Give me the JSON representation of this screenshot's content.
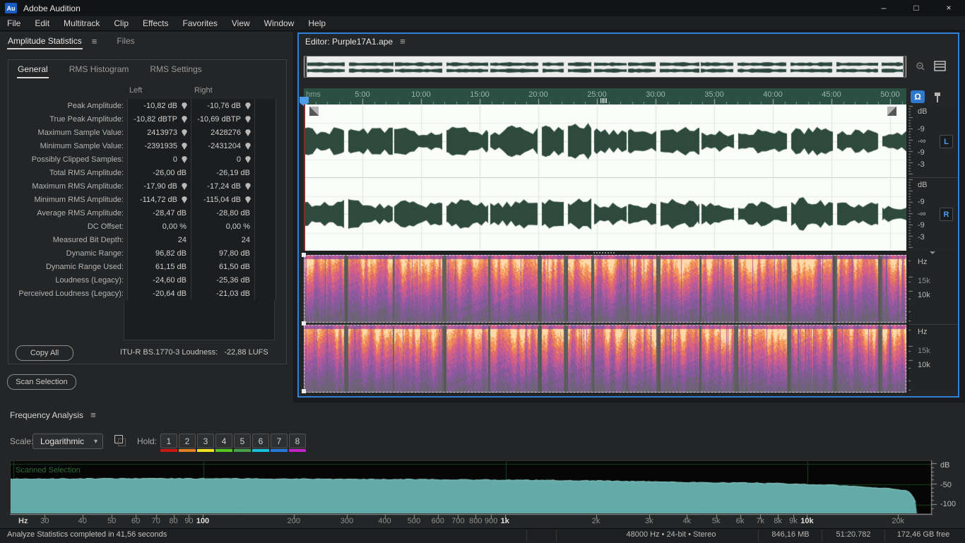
{
  "titlebar": {
    "logo": "Au",
    "title": "Adobe Audition",
    "minimize": "–",
    "maximize": "□",
    "close": "×"
  },
  "menubar": {
    "items": [
      "File",
      "Edit",
      "Multitrack",
      "Clip",
      "Effects",
      "Favorites",
      "View",
      "Window",
      "Help"
    ]
  },
  "icons": {
    "menu": "≡",
    "dropdown_arrow": "▾",
    "monitor": "Ω"
  },
  "stats": {
    "panel_tabs": [
      {
        "label": "Amplitude Statistics",
        "active": true
      },
      {
        "label": "Files",
        "active": false
      }
    ],
    "inner_tabs": [
      {
        "label": "General",
        "active": true
      },
      {
        "label": "RMS Histogram",
        "active": false
      },
      {
        "label": "RMS Settings",
        "active": false
      }
    ],
    "columns": [
      "Left",
      "Right"
    ],
    "rows": [
      {
        "label": "Peak Amplitude:",
        "left": "-10,82 dB",
        "right": "-10,76 dB",
        "marker": true
      },
      {
        "label": "True Peak Amplitude:",
        "left": "-10,82 dBTP",
        "right": "-10,69 dBTP",
        "marker": true
      },
      {
        "label": "Maximum Sample Value:",
        "left": "2413973",
        "right": "2428276",
        "marker": true
      },
      {
        "label": "Minimum Sample Value:",
        "left": "-2391935",
        "right": "-2431204",
        "marker": true
      },
      {
        "label": "Possibly Clipped Samples:",
        "left": "0",
        "right": "0",
        "marker": true
      },
      {
        "label": "Total RMS Amplitude:",
        "left": "-26,00 dB",
        "right": "-26,19 dB",
        "marker": false
      },
      {
        "label": "Maximum RMS Amplitude:",
        "left": "-17,90 dB",
        "right": "-17,24 dB",
        "marker": true
      },
      {
        "label": "Minimum RMS Amplitude:",
        "left": "-114,72 dB",
        "right": "-115,04 dB",
        "marker": true
      },
      {
        "label": "Average RMS Amplitude:",
        "left": "-28,47 dB",
        "right": "-28,80 dB",
        "marker": false
      },
      {
        "label": "DC Offset:",
        "left": "0,00 %",
        "right": "0,00 %",
        "marker": false
      },
      {
        "label": "Measured Bit Depth:",
        "left": "24",
        "right": "24",
        "marker": false
      },
      {
        "label": "Dynamic Range:",
        "left": "96,82 dB",
        "right": "97,80 dB",
        "marker": false
      },
      {
        "label": "Dynamic Range Used:",
        "left": "61,15 dB",
        "right": "61,50 dB",
        "marker": false
      },
      {
        "label": "Loudness (Legacy):",
        "left": "-24,60 dB",
        "right": "-25,36 dB",
        "marker": false
      },
      {
        "label": "Perceived Loudness (Legacy):",
        "left": "-20,64 dB",
        "right": "-21,03 dB",
        "marker": false
      }
    ],
    "copy_all": "Copy All",
    "loudness_text": "ITU-R BS.1770-3 Loudness:   -22,88 LUFS",
    "scan_selection": "Scan Selection"
  },
  "editor": {
    "tab": "Editor: Purple17A1.ape",
    "timeline_unit": "hms",
    "timeline_ticks": [
      "5:00",
      "10:00",
      "15:00",
      "20:00",
      "25:00",
      "30:00",
      "35:00",
      "40:00",
      "45:00",
      "50:00"
    ],
    "amp_labels": [
      "dB",
      "-9",
      "-∞",
      "-9",
      "-3"
    ],
    "channel_left": "L",
    "channel_right": "R",
    "freq_labels": [
      "Hz",
      "15k",
      "10k"
    ]
  },
  "freq": {
    "title": "Frequency Analysis",
    "scale_label": "Scale:",
    "scale_value": "Logarithmic",
    "hold_label": "Hold:",
    "holds": [
      {
        "label": "1",
        "color": "#cf1616"
      },
      {
        "label": "2",
        "color": "#e2821e"
      },
      {
        "label": "3",
        "color": "#efe51d"
      },
      {
        "label": "4",
        "color": "#55c81e"
      },
      {
        "label": "5",
        "color": "#46a14a"
      },
      {
        "label": "6",
        "color": "#17bfd8"
      },
      {
        "label": "7",
        "color": "#2579d8"
      },
      {
        "label": "8",
        "color": "#c324c9"
      }
    ],
    "annotation": "Scanned Selection",
    "x_unit": "Hz",
    "x_ticks": [
      {
        "f": 30,
        "label": "30",
        "bold": false
      },
      {
        "f": 40,
        "label": "40",
        "bold": false
      },
      {
        "f": 50,
        "label": "50",
        "bold": false
      },
      {
        "f": 60,
        "label": "60",
        "bold": false
      },
      {
        "f": 70,
        "label": "70",
        "bold": false
      },
      {
        "f": 80,
        "label": "80",
        "bold": false
      },
      {
        "f": 90,
        "label": "90",
        "bold": false
      },
      {
        "f": 100,
        "label": "100",
        "bold": true
      },
      {
        "f": 200,
        "label": "200",
        "bold": false
      },
      {
        "f": 300,
        "label": "300",
        "bold": false
      },
      {
        "f": 400,
        "label": "400",
        "bold": false
      },
      {
        "f": 500,
        "label": "500",
        "bold": false
      },
      {
        "f": 600,
        "label": "600",
        "bold": false
      },
      {
        "f": 700,
        "label": "700",
        "bold": false
      },
      {
        "f": 800,
        "label": "800",
        "bold": false
      },
      {
        "f": 900,
        "label": "900",
        "bold": false
      },
      {
        "f": 1000,
        "label": "1k",
        "bold": true
      },
      {
        "f": 2000,
        "label": "2k",
        "bold": false
      },
      {
        "f": 3000,
        "label": "3k",
        "bold": false
      },
      {
        "f": 4000,
        "label": "4k",
        "bold": false
      },
      {
        "f": 5000,
        "label": "5k",
        "bold": false
      },
      {
        "f": 6000,
        "label": "6k",
        "bold": false
      },
      {
        "f": 7000,
        "label": "7k",
        "bold": false
      },
      {
        "f": 8000,
        "label": "8k",
        "bold": false
      },
      {
        "f": 9000,
        "label": "9k",
        "bold": false
      },
      {
        "f": 10000,
        "label": "10k",
        "bold": true
      },
      {
        "f": 20000,
        "label": "20k",
        "bold": false
      }
    ],
    "y_unit": "dB",
    "y_ticks": [
      {
        "db": -50,
        "label": "-50"
      },
      {
        "db": -100,
        "label": "-100"
      }
    ]
  },
  "status": {
    "message": "Analyze Statistics completed in 41,56 seconds",
    "format": "48000 Hz • 24-bit • Stereo",
    "size": "846,16 MB",
    "position": "51:20.782",
    "free": "172,46 GB free"
  }
}
